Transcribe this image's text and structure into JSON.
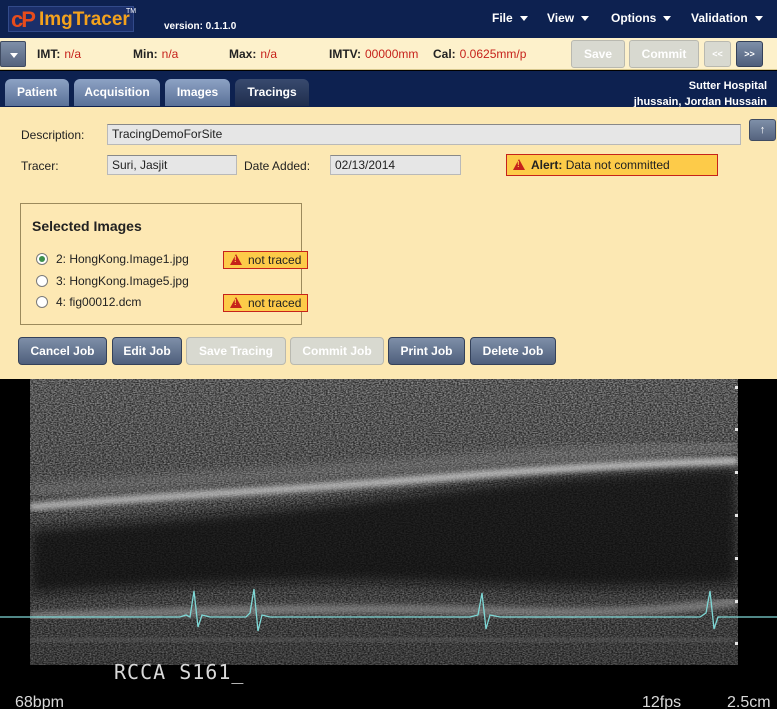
{
  "app": {
    "name": "ImgTracer",
    "mark": "cP",
    "tm": "TM",
    "version": "version: 0.1.1.0"
  },
  "menu": [
    "File",
    "View",
    "Options",
    "Validation"
  ],
  "status": {
    "imt_label": "IMT:",
    "imt_value": "n/a",
    "min_label": "Min:",
    "min_value": "n/a",
    "max_label": "Max:",
    "max_value": "n/a",
    "imtv_label": "IMTV:",
    "imtv_value": "00000mm",
    "cal_label": "Cal:",
    "cal_value": "0.0625mm/p",
    "save_label": "Save",
    "commit_label": "Commit",
    "prev_label": "<<",
    "next_label": ">>"
  },
  "tabs": [
    "Patient",
    "Acquisition",
    "Images",
    "Tracings"
  ],
  "active_tab": "Tracings",
  "header_right": {
    "hospital": "Sutter Hospital",
    "user": "jhussain, Jordan Hussain"
  },
  "form": {
    "description_label": "Description:",
    "description_value": "TracingDemoForSite",
    "tracer_label": "Tracer:",
    "tracer_value": "Suri, Jasjit",
    "date_label": "Date Added:",
    "date_value": "02/13/2014",
    "upload_glyph": "↑",
    "alert_title": "Alert:",
    "alert_text": "Data not committed"
  },
  "selected_images": {
    "title": "Selected Images",
    "items": [
      {
        "label": "2: HongKong.Image1.jpg",
        "selected": true,
        "badge": "not traced"
      },
      {
        "label": "3: HongKong.Image5.jpg",
        "selected": false,
        "badge": ""
      },
      {
        "label": "4: fig00012.dcm",
        "selected": false,
        "badge": "not traced"
      }
    ]
  },
  "actions": {
    "cancel": "Cancel Job",
    "edit": "Edit Job",
    "save_tracing": "Save Tracing",
    "commit_job": "Commit Job",
    "print": "Print Job",
    "delete": "Delete Job"
  },
  "viewer": {
    "overlay": "RCCA S161_",
    "bpm": "68bpm",
    "fps": "12fps",
    "depth": "2.5cm"
  },
  "colors": {
    "navy": "#0d2150",
    "panel": "#fce8b3",
    "alert_red": "#c6221b",
    "warning_fill": "#fdcb49",
    "ecg": "#7fd8d6"
  }
}
